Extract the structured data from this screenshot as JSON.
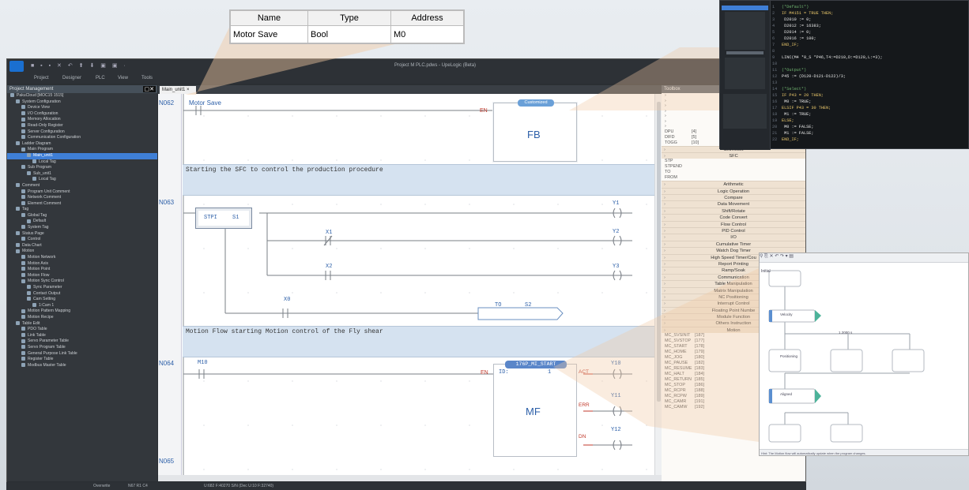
{
  "tag_table": {
    "headers": [
      "Name",
      "Type",
      "Address"
    ],
    "row": [
      "Motor Save",
      "Bool",
      "M0"
    ]
  },
  "window": {
    "title": "Project M PLC.pdws - UpeLogic (Beta)",
    "menu": [
      "Project",
      "Designer",
      "PLC",
      "View",
      "Tools"
    ]
  },
  "project_panel": {
    "title": "Project Management",
    "items": [
      {
        "label": "PakuCloud [MOC15 1515]",
        "depth": 0
      },
      {
        "label": "System Configuration",
        "depth": 1
      },
      {
        "label": "Device View",
        "depth": 2
      },
      {
        "label": "I/O Configuration",
        "depth": 2
      },
      {
        "label": "Memory Allocation",
        "depth": 2
      },
      {
        "label": "Read-Only Register",
        "depth": 2
      },
      {
        "label": "Server Configuration",
        "depth": 2
      },
      {
        "label": "Communication Configuration",
        "depth": 2
      },
      {
        "label": "Ladder Diagram",
        "depth": 1
      },
      {
        "label": "Main Program",
        "depth": 2
      },
      {
        "label": "Main_unit1",
        "depth": 3,
        "selected": true
      },
      {
        "label": "Local Tag",
        "depth": 4
      },
      {
        "label": "Sub Program",
        "depth": 2
      },
      {
        "label": "Sub_unit1",
        "depth": 3
      },
      {
        "label": "Local Tag",
        "depth": 4
      },
      {
        "label": "Comment",
        "depth": 1
      },
      {
        "label": "Program Unit Comment",
        "depth": 2
      },
      {
        "label": "Network Comment",
        "depth": 2
      },
      {
        "label": "Element Comment",
        "depth": 2
      },
      {
        "label": "Tag",
        "depth": 1
      },
      {
        "label": "Global Tag",
        "depth": 2
      },
      {
        "label": "Default",
        "depth": 3
      },
      {
        "label": "System Tag",
        "depth": 2
      },
      {
        "label": "Status Page",
        "depth": 1
      },
      {
        "label": "Control",
        "depth": 2
      },
      {
        "label": "Data Chart",
        "depth": 1
      },
      {
        "label": "Motion",
        "depth": 1
      },
      {
        "label": "Motion Network",
        "depth": 2
      },
      {
        "label": "Motion Axis",
        "depth": 2
      },
      {
        "label": "Motion Point",
        "depth": 2
      },
      {
        "label": "Motion Flow",
        "depth": 2
      },
      {
        "label": "Motion Sync Control",
        "depth": 2
      },
      {
        "label": "Sync Parameter",
        "depth": 3
      },
      {
        "label": "Contact Output",
        "depth": 3
      },
      {
        "label": "Cam Setting",
        "depth": 3
      },
      {
        "label": "1:Cam 1",
        "depth": 4
      },
      {
        "label": "Motion Pattern Mapping",
        "depth": 2
      },
      {
        "label": "Motion Recipe",
        "depth": 2
      },
      {
        "label": "Table Edit",
        "depth": 1
      },
      {
        "label": "PDO Table",
        "depth": 2
      },
      {
        "label": "Link Table",
        "depth": 2
      },
      {
        "label": "Servo Parameter Table",
        "depth": 2
      },
      {
        "label": "Servo Program Table",
        "depth": 2
      },
      {
        "label": "General Purpose Link Table",
        "depth": 2
      },
      {
        "label": "Register Table",
        "depth": 2
      },
      {
        "label": "Modbus Master Table",
        "depth": 2
      }
    ]
  },
  "editor": {
    "tab": "Main_unit1",
    "networks": [
      "N062",
      "N063",
      "N064",
      "N065"
    ],
    "n062": {
      "contact": "Motor Save",
      "badge": "Customized",
      "fb": "FB",
      "en": "EN"
    },
    "comment1": "Starting the SFC to control the production procedure",
    "n063": {
      "stp": "STPI",
      "s1": "S1",
      "x1": "X1",
      "x2": "X2",
      "x0": "X0",
      "y1": "Y1",
      "y2": "Y2",
      "y3": "Y3",
      "to": "TO",
      "s2": "S2"
    },
    "comment2": "Motion Flow starting Motion control of the Fly shear",
    "n064": {
      "contact": "M10",
      "header": "176P_MI_START",
      "id_label": "ID:",
      "id_value": "1",
      "en": "EN",
      "act": "ACT",
      "err": "ERR",
      "dn": "DN",
      "y10": "Y10",
      "y11": "Y11",
      "y12": "Y12",
      "mf": "MF"
    }
  },
  "toolbox": {
    "title": "Toolbox",
    "top_items": [
      [
        "DPU",
        "[4]"
      ],
      [
        "DIFD",
        "[5]"
      ],
      [
        "TOGG",
        "[10]"
      ]
    ],
    "set_reset": "Set/Reset",
    "sfc": "SFC",
    "sfc_items": [
      "STP",
      "STPEND",
      "TO",
      "FROM"
    ],
    "categories": [
      "Arithmetic",
      "Logic Operation",
      "Compare",
      "Data Movement",
      "Shift/Rotate",
      "Code Convert",
      "Flow Control",
      "PID Control",
      "I/O",
      "Cumulative Timer",
      "Watch Dog Timer",
      "High Speed Timer/Cou",
      "Report Printing",
      "Ramp/Soak",
      "Communication",
      "Table Manipulation",
      "Matrix Manipulation",
      "NC Positioning",
      "Interrupt Control",
      "Floating Point Numbe",
      "Module Function",
      "Others Instruction",
      "Motion"
    ],
    "motion_items": [
      [
        "MC_SVSINIT",
        "[187]"
      ],
      [
        "MC_SVSTOP",
        "[177]"
      ],
      [
        "MC_START",
        "[178]"
      ],
      [
        "MC_HOME",
        "[179]"
      ],
      [
        "MC_JOG",
        "[180]"
      ],
      [
        "MC_PAUSE",
        "[182]"
      ],
      [
        "MC_RESUME",
        "[183]"
      ],
      [
        "MC_HALT",
        "[184]"
      ],
      [
        "MC_RETURN",
        "[185]"
      ],
      [
        "MC_STOP",
        "[186]"
      ],
      [
        "MC_RCPR",
        "[188]"
      ],
      [
        "MC_RCPW",
        "[189]"
      ],
      [
        "MC_CAMR",
        "[191]"
      ],
      [
        "MC_CAMW",
        "[192]"
      ]
    ]
  },
  "status_bar": {
    "mode": "Overwrite",
    "position": "N67 R1 C4",
    "info": "U:682 F:40270 S/N (Dec U:10 F:32740)"
  },
  "code_window": {
    "lines": [
      "(*Default*)",
      "IF M4151 = TRUE THEN;",
      "  D2010 := 0;",
      "  D2012 := 16383;",
      "  D2014 := 0;",
      "  D2016 := 100;",
      "END_IF;",
      "",
      "LINC(M4 *0_S *P46,T4:=D210,D:=D120,L:=3);",
      "",
      "(*Output*)",
      "P45 := (D120-D121-D122)/3;",
      "",
      "(*Select*)",
      "IF P43 = 20 THEN;",
      "  M0 := TRUE;",
      "ELSIF P43 = 30 THEN;",
      "  M1 := TRUE;",
      "ELSE;",
      "  M0 := FALSE;",
      "  M1 := FALSE;",
      "END_IF;"
    ]
  },
  "sfc_window": {
    "steps": [
      "Initial",
      "Velocity",
      "Cam Start",
      "Aligned",
      "Decelerate"
    ],
    "transition_labels": [
      "1.2000 s"
    ],
    "positioning_label": "Positioning",
    "footer": "Hint: The Motion flow will automatically update when the program changes."
  },
  "colors": {
    "accent": "#3f7fd6",
    "fb_badge": "#6aa0d8",
    "comment_bg": "#d5e2f0",
    "toolbox_header": "#efe2d2",
    "highlight": "#f3d8bc"
  }
}
